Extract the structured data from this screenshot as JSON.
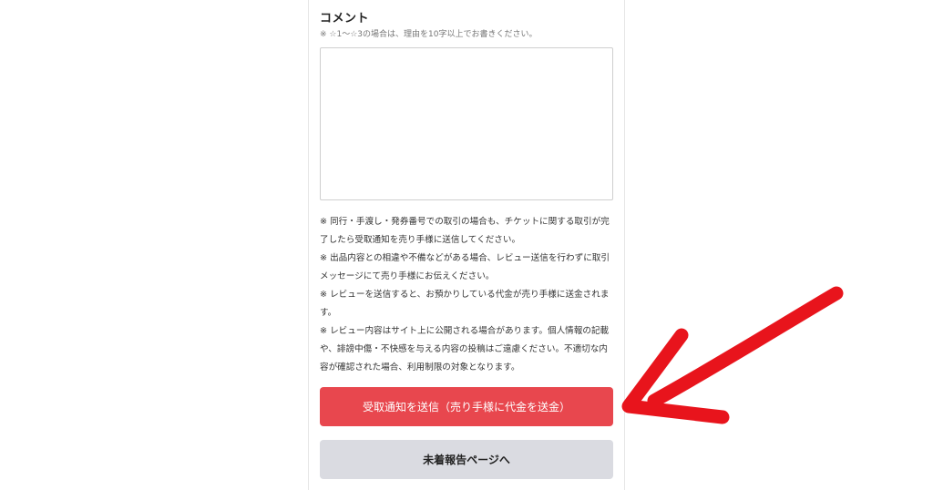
{
  "comment": {
    "title": "コメント",
    "hint": "※ ☆1〜☆3の場合は、理由を10字以上でお書きください。",
    "value": "",
    "placeholder": ""
  },
  "notes": [
    "※ 同行・手渡し・発券番号での取引の場合も、チケットに関する取引が完了したら受取通知を売り手様に送信してください。",
    "※ 出品内容との相違や不備などがある場合、レビュー送信を行わずに取引メッセージにて売り手様にお伝えください。",
    "※ レビューを送信すると、お預かりしている代金が売り手様に送金されます。",
    "※ レビュー内容はサイト上に公開される場合があります。個人情報の記載や、誹謗中傷・不快感を与える内容の投稿はご遠慮ください。不適切な内容が確認された場合、利用制限の対象となります。"
  ],
  "buttons": {
    "submit_label": "受取通知を送信（売り手様に代金を送金）",
    "report_label": "未着報告ページへ"
  },
  "annotation": {
    "arrow_icon": "red-arrow-icon",
    "arrow_color": "#e8141c"
  },
  "colors": {
    "primary_button": "#e8474e",
    "secondary_button": "#dadbe1"
  }
}
